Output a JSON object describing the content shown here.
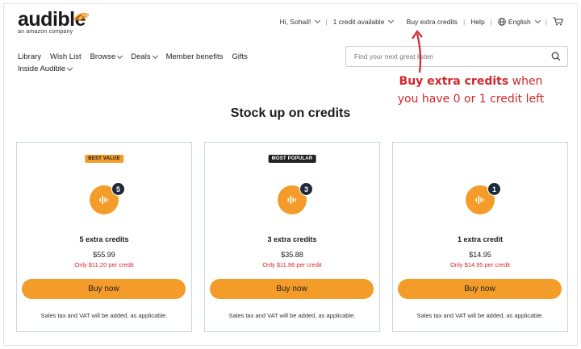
{
  "brand": {
    "name": "audible",
    "tagline": "an amazon company"
  },
  "topnav": {
    "greeting": "Hi, Sohail!",
    "credits": "1 credit available",
    "buy_extra": "Buy extra credits",
    "help": "Help",
    "language": "English",
    "separator": "|"
  },
  "mainnav": {
    "row1": [
      "Library",
      "Wish List",
      "Browse",
      "Deals",
      "Member benefits",
      "Gifts"
    ],
    "row2": [
      "Inside Audible"
    ]
  },
  "search": {
    "placeholder": "Find your next great listen"
  },
  "annotation": {
    "bold": "Buy extra credits",
    "rest1": " when",
    "line2": "you have 0 or 1 credit left"
  },
  "page_title": "Stock up on credits",
  "cards": [
    {
      "badge": "BEST VALUE",
      "count": "5",
      "name": "5 extra credits",
      "price": "$55.99",
      "per_credit": "Only $11.20 per credit",
      "button": "Buy now",
      "tax_note": "Sales tax and VAT will be added, as applicable."
    },
    {
      "badge": "MOST POPULAR",
      "count": "3",
      "name": "3 extra credits",
      "price": "$35.88",
      "per_credit": "Only $11.96 per credit",
      "button": "Buy now",
      "tax_note": "Sales tax and VAT will be added, as applicable."
    },
    {
      "badge": "",
      "count": "1",
      "name": "1 extra credit",
      "price": "$14.95",
      "per_credit": "Only $14.95 per credit",
      "button": "Buy now",
      "tax_note": "Sales tax and VAT will be added, as applicable."
    }
  ],
  "colors": {
    "accent": "#f39c2a",
    "annotation": "#d3272b",
    "card_border": "#c8d8ea",
    "count_bg": "#1c2a3a"
  },
  "icons": [
    "audible-logo-icon",
    "chevron-down-icon",
    "globe-icon",
    "cart-icon",
    "search-icon",
    "audio-bars-icon",
    "arrow-up-icon"
  ]
}
